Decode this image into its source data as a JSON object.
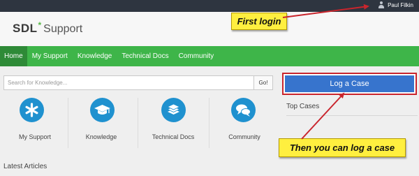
{
  "topbar": {
    "user_name": "Paul Filkin"
  },
  "logo": {
    "brand": "SDL",
    "star": "*",
    "product": "Support"
  },
  "nav": [
    {
      "label": "Home",
      "active": true
    },
    {
      "label": "My Support",
      "active": false
    },
    {
      "label": "Knowledge",
      "active": false
    },
    {
      "label": "Technical Docs",
      "active": false
    },
    {
      "label": "Community",
      "active": false
    }
  ],
  "search": {
    "placeholder": "Search for Knowledge...",
    "go_label": "Go!"
  },
  "tiles": [
    {
      "label": "My Support",
      "icon": "asterisk-icon"
    },
    {
      "label": "Knowledge",
      "icon": "graduation-cap-icon"
    },
    {
      "label": "Technical Docs",
      "icon": "document-stack-icon"
    },
    {
      "label": "Community",
      "icon": "chat-bubbles-icon"
    }
  ],
  "latest_articles": "Latest Articles",
  "right": {
    "log_case_label": "Log a Case",
    "top_cases": "Top Cases"
  },
  "callouts": {
    "first_login": "First login",
    "then_log_case": "Then you can log a case"
  },
  "colors": {
    "nav": "#3eb549",
    "nav_active": "#2e8a37",
    "topbar": "#2e3540",
    "icon_circle": "#1f91cf",
    "log_case_button": "#3774cd",
    "callout": "#ffef3f",
    "highlight_border": "#c9252d"
  }
}
